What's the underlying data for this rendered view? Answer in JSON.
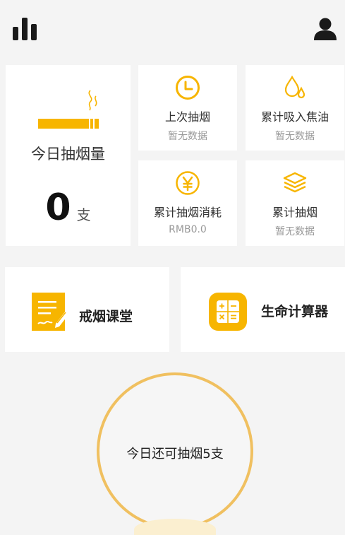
{
  "header": {
    "left_icon": "bar-chart-icon",
    "right_icon": "user-icon"
  },
  "today": {
    "label": "今日抽烟量",
    "count": "0",
    "unit": "支",
    "icon": "cigarette-icon"
  },
  "stats": [
    {
      "title": "上次抽烟",
      "value": "暂无数据",
      "icon": "clock-icon"
    },
    {
      "title": "累计吸入焦油",
      "value": "暂无数据",
      "icon": "droplet-icon"
    },
    {
      "title": "累计抽烟消耗",
      "value": "RMB0.0",
      "icon": "yen-coin-icon"
    },
    {
      "title": "累计抽烟",
      "value": "暂无数据",
      "icon": "layers-icon"
    }
  ],
  "features": [
    {
      "label": "戒烟课堂",
      "icon": "notebook-pen-icon"
    },
    {
      "label": "生命计算器",
      "icon": "calculator-icon"
    }
  ],
  "remaining": {
    "text": "今日还可抽烟5支"
  },
  "colors": {
    "accent": "#f7b500",
    "ring": "#f0c060",
    "background": "#f4f4f4",
    "card": "#ffffff"
  }
}
